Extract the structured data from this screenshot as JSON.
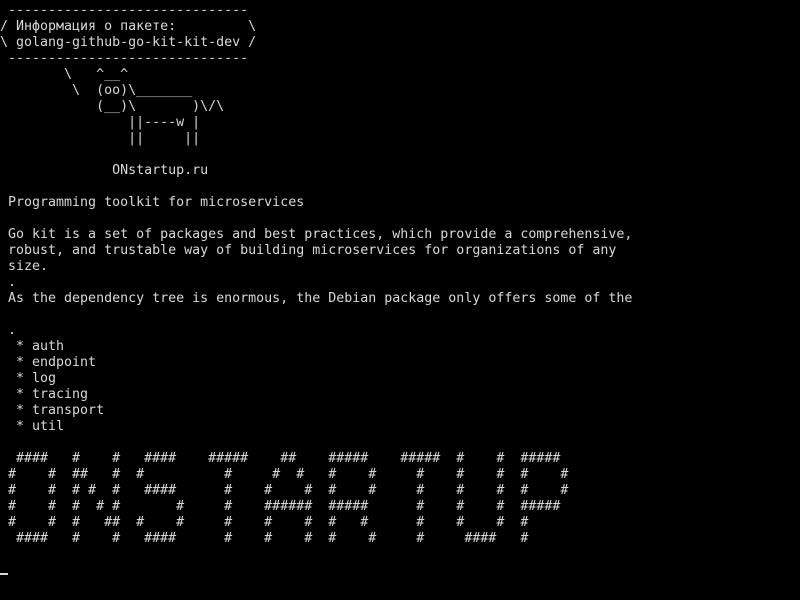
{
  "terminal": {
    "lines": [
      " ------------------------------",
      "/ Информация о пакете:         \\",
      "\\ golang-github-go-kit-kit-dev /",
      " ------------------------------",
      "        \\   ^__^",
      "         \\  (oo)\\_______",
      "            (__)\\       )\\/\\",
      "                ||----w |",
      "                ||     ||",
      "",
      "              ONstartup.ru",
      "",
      " Programming toolkit for microservices",
      "",
      " Go kit is a set of packages and best practices, which provide a comprehensive,",
      " robust, and trustable way of building microservices for organizations of any",
      " size.",
      " .",
      " As the dependency tree is enormous, the Debian package only offers some of the",
      "",
      " .",
      "  * auth",
      "  * endpoint",
      "  * log",
      "  * tracing",
      "  * transport",
      "  * util",
      "",
      "  ####   #    #   ####    #####    ##    #####    #####  #    #  #####",
      " #    #  ##   #  #          #     #  #   #    #     #    #    #  #    #",
      " #    #  # #  #   ####      #    #    #  #    #     #    #    #  #    #",
      " #    #  #  # #       #     #    ######  #####      #    #    #  #####",
      " #    #  #   ##  #    #     #    #    #  #   #      #    #    #  #",
      "  ####   #    #   ####      #    #    #  #    #     #     ####   #"
    ],
    "cursor": "_"
  }
}
